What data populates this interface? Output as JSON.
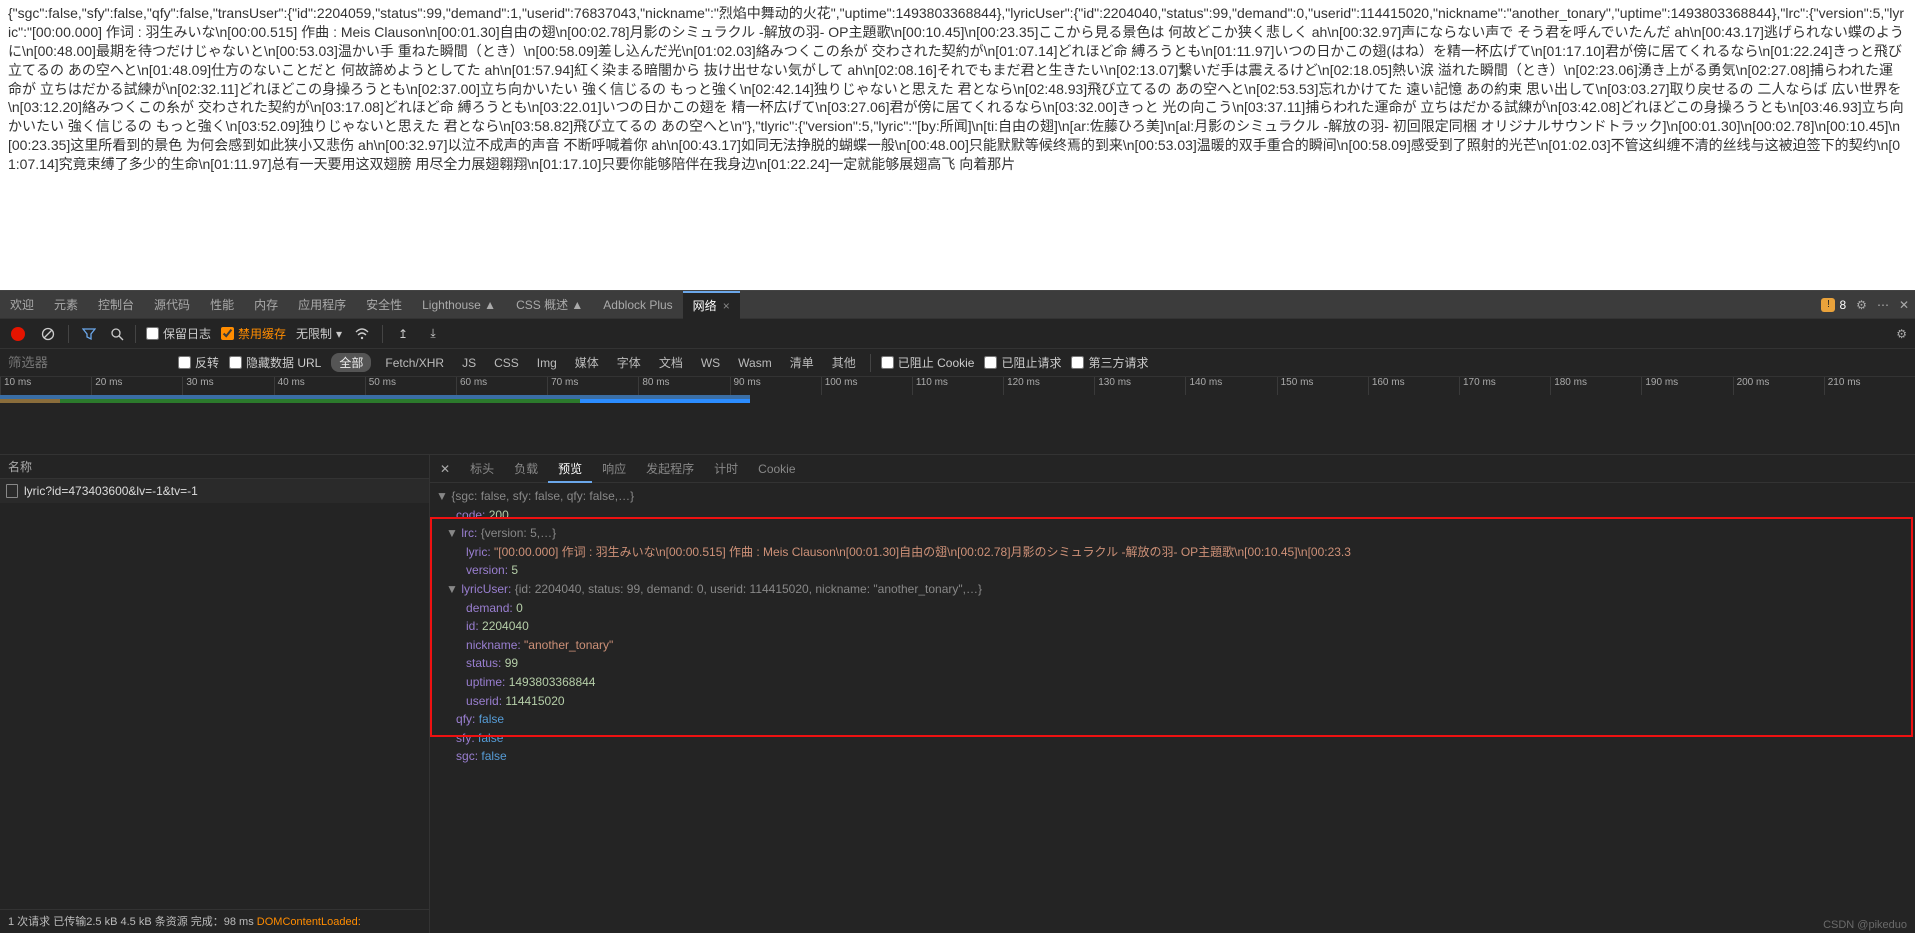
{
  "page_text": "{\"sgc\":false,\"sfy\":false,\"qfy\":false,\"transUser\":{\"id\":2204059,\"status\":99,\"demand\":1,\"userid\":76837043,\"nickname\":\"烈焰中舞动的火花\",\"uptime\":1493803368844},\"lyricUser\":{\"id\":2204040,\"status\":99,\"demand\":0,\"userid\":114415020,\"nickname\":\"another_tonary\",\"uptime\":1493803368844},\"lrc\":{\"version\":5,\"lyric\":\"[00:00.000] 作词 : 羽生みいな\\n[00:00.515] 作曲 : Meis Clauson\\n[00:01.30]自由の翅\\n[00:02.78]月影のシミュラクル -解放の羽- OP主題歌\\n[00:10.45]\\n[00:23.35]ここから見る景色は 何故どこか狭く悲しく ah\\n[00:32.97]声にならない声で そう君を呼んでいたんだ ah\\n[00:43.17]逃げられない蝶のように\\n[00:48.00]最期を待つだけじゃないと\\n[00:53.03]温かい手 重ねた瞬間（とき）\\n[00:58.09]差し込んだ光\\n[01:02.03]絡みつくこの糸が 交わされた契約が\\n[01:07.14]どれほど命 縛ろうとも\\n[01:11.97]いつの日かこの翅(はね）を精一杯広げて\\n[01:17.10]君が傍に居てくれるなら\\n[01:22.24]きっと飛び立てるの あの空へと\\n[01:48.09]仕方のないことだと 何故諦めようとしてた ah\\n[01:57.94]紅く染まる暗闇から 抜け出せない気がして ah\\n[02:08.16]それでもまだ君と生きたい\\n[02:13.07]繋いだ手は震えるけど\\n[02:18.05]熱い涙 溢れた瞬間（とき）\\n[02:23.06]湧き上がる勇気\\n[02:27.08]捕らわれた運命が 立ちはだかる試練が\\n[02:32.11]どれほどこの身操ろうとも\\n[02:37.00]立ち向かいたい 強く信じるの もっと強く\\n[02:42.14]独りじゃないと思えた 君となら\\n[02:48.93]飛び立てるの あの空へと\\n[02:53.53]忘れかけてた 遠い記憶 あの約束 思い出して\\n[03:03.27]取り戻せるの 二人ならば 広い世界を\\n[03:12.20]絡みつくこの糸が 交わされた契約が\\n[03:17.08]どれほど命 縛ろうとも\\n[03:22.01]いつの日かこの翅を 精一杯広げて\\n[03:27.06]君が傍に居てくれるなら\\n[03:32.00]きっと 光の向こう\\n[03:37.11]捕らわれた運命が 立ちはだかる試練が\\n[03:42.08]どれほどこの身操ろうとも\\n[03:46.93]立ち向かいたい 強く信じるの もっと強く\\n[03:52.09]独りじゃないと思えた 君となら\\n[03:58.82]飛び立てるの あの空へと\\n\"},\"tlyric\":{\"version\":5,\"lyric\":\"[by:所闻]\\n[ti:自由の翅]\\n[ar:佐藤ひろ美]\\n[al:月影のシミュラクル -解放の羽- 初回限定同梱 オリジナルサウンドトラック]\\n[00:01.30]\\n[00:02.78]\\n[00:10.45]\\n[00:23.35]这里所看到的景色 为何会感到如此狭小又悲伤 ah\\n[00:32.97]以泣不成声的声音 不断呼喊着你 ah\\n[00:43.17]如同无法挣脱的蝴蝶一般\\n[00:48.00]只能默默等候终焉的到来\\n[00:53.03]温暖的双手重合的瞬间\\n[00:58.09]感受到了照射的光芒\\n[01:02.03]不管这纠缠不清的丝线与这被迫签下的契约\\n[01:07.14]究竟束缚了多少的生命\\n[01:11.97]总有一天要用这双翅膀 用尽全力展翅翱翔\\n[01:17.10]只要你能够陪伴在我身边\\n[01:22.24]一定就能够展翅高飞 向着那片",
  "devtools": {
    "tabs": [
      "欢迎",
      "元素",
      "控制台",
      "源代码",
      "性能",
      "内存",
      "应用程序",
      "安全性",
      "Lighthouse ▲",
      "CSS 概述 ▲",
      "Adblock Plus",
      "网络"
    ],
    "active_tab": "网络",
    "warn_count": "8",
    "toolbar": {
      "keep_log": "保留日志",
      "disable_cache": "禁用缓存",
      "throttle": "无限制"
    },
    "filterbar": {
      "placeholder": "筛选器",
      "invert": "反转",
      "hide_data": "隐藏数据 URL",
      "types": [
        "全部",
        "Fetch/XHR",
        "JS",
        "CSS",
        "Img",
        "媒体",
        "字体",
        "文档",
        "WS",
        "Wasm",
        "清单",
        "其他"
      ],
      "blocked_cookie": "已阻止 Cookie",
      "blocked_req": "已阻止请求",
      "third_party": "第三方请求"
    },
    "ruler": [
      "10 ms",
      "20 ms",
      "30 ms",
      "40 ms",
      "50 ms",
      "60 ms",
      "70 ms",
      "80 ms",
      "90 ms",
      "100 ms",
      "110 ms",
      "120 ms",
      "130 ms",
      "140 ms",
      "150 ms",
      "160 ms",
      "170 ms",
      "180 ms",
      "190 ms",
      "200 ms",
      "210 ms"
    ],
    "reqlist": {
      "header": "名称",
      "row0": "lyric?id=473403600&lv=-1&tv=-1"
    },
    "statusbar": {
      "left": "1 次请求  已传输2.5 kB  4.5 kB 条资源  完成：98 ms",
      "dom": "DOMContentLoaded:"
    },
    "detail_tabs": [
      "标头",
      "负载",
      "预览",
      "响应",
      "发起程序",
      "计时",
      "Cookie"
    ],
    "preview": {
      "l0": "{sgc: false, sfy: false, qfy: false,…}",
      "code_k": "code:",
      "code_v": "200",
      "lrc_head": "lrc: ",
      "lrc_sum": "{version: 5,…}",
      "lyric_k": "lyric: ",
      "lyric_v": "\"[00:00.000] 作词 : 羽生みいな\\n[00:00.515] 作曲 : Meis Clauson\\n[00:01.30]自由の翅\\n[00:02.78]月影のシミュラクル -解放の羽- OP主題歌\\n[00:10.45]\\n[00:23.3",
      "ver_k": "version: ",
      "ver_v": "5",
      "lu_head": "lyricUser: ",
      "lu_sum": "{id: 2204040, status: 99, demand: 0, userid: 114415020, nickname: \"another_tonary\",…}",
      "demand_k": "demand: ",
      "demand_v": "0",
      "id_k": "id: ",
      "id_v": "2204040",
      "nick_k": "nickname: ",
      "nick_v": "\"another_tonary\"",
      "status_k": "status: ",
      "status_v": "99",
      "uptime_k": "uptime: ",
      "uptime_v": "1493803368844",
      "userid_k": "userid: ",
      "userid_v": "114415020",
      "qfy_k": "qfy: ",
      "qfy_v": "false",
      "sfy_k": "sfy: ",
      "sfy_v": "false",
      "sgc_k": "sgc: ",
      "sgc_v": "false"
    }
  },
  "watermark": "CSDN @pikeduo"
}
